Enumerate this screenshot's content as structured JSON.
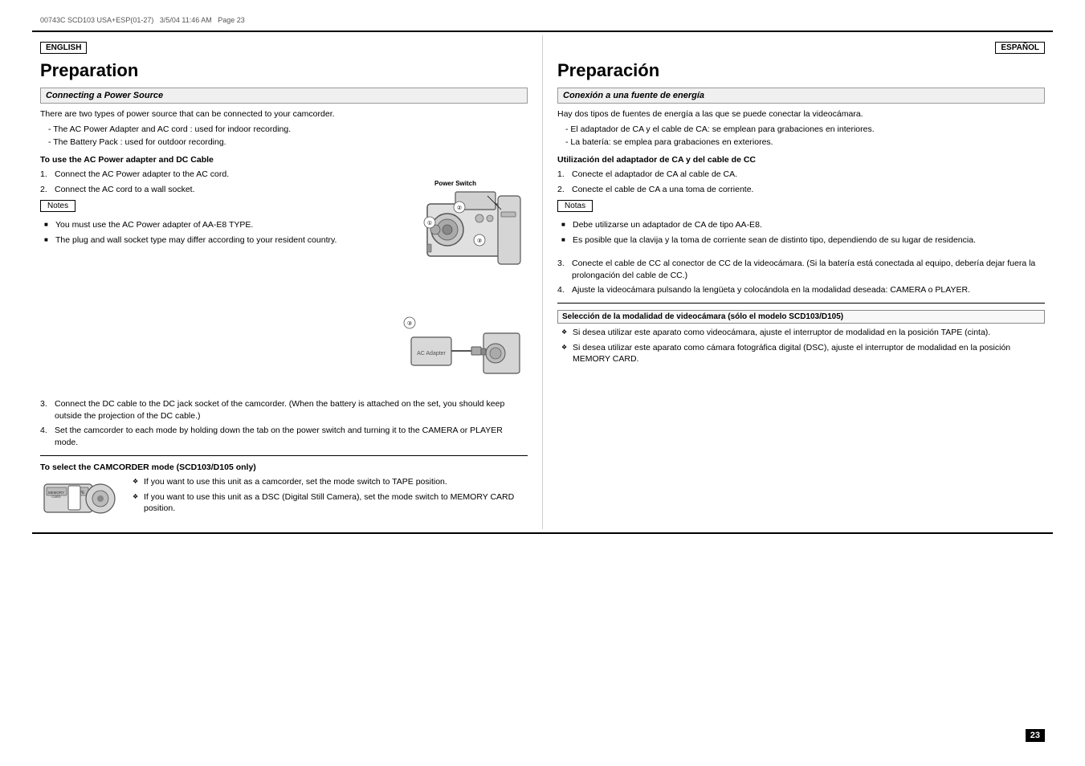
{
  "meta": {
    "doc_id": "00743C SCD103 USA+ESP(01-27)",
    "date": "3/5/04 11:46 AM",
    "page": "Page 23"
  },
  "english": {
    "lang_badge": "ENGLISH",
    "title": "Preparation",
    "section1": {
      "header": "Connecting a Power Source",
      "intro": "There are two types of power source that can be connected to your camcorder.",
      "bullets": [
        "The AC Power Adapter and AC cord : used for indoor recording.",
        "The Battery Pack : used for outdoor recording."
      ],
      "subheading": "To use the AC Power adapter and DC Cable",
      "steps": [
        "Connect the AC Power adapter to the AC cord.",
        "Connect the AC cord to a wall socket.",
        "Connect the DC cable to the DC jack socket of the camcorder. (When the battery is attached on the set, you should keep outside the projection of the DC cable.)",
        "Set the camcorder to each mode by holding down the tab on the power switch and turning it to the CAMERA or PLAYER mode."
      ],
      "notes_label": "Notes",
      "notes": [
        "You must use the AC Power adapter of AA-E8 TYPE.",
        "The plug and wall socket type may differ according to your resident country."
      ]
    },
    "section2": {
      "subheading": "To select the CAMCORDER mode (SCD103/D105 only)",
      "bullets": [
        "If you want to use this unit as a camcorder, set the mode switch to TAPE position.",
        "If you want to use this unit as a DSC (Digital Still Camera), set the mode switch to MEMORY CARD position."
      ]
    },
    "power_switch_label": "Power Switch"
  },
  "spanish": {
    "lang_badge": "ESPAÑOL",
    "title": "Preparación",
    "section1": {
      "header": "Conexión a una fuente de energía",
      "intro": "Hay dos tipos de fuentes de energía a las que se puede conectar la videocámara.",
      "bullets": [
        "El adaptador de CA y el cable de CA: se emplean para grabaciones en interiores.",
        "La batería: se emplea para grabaciones en exteriores."
      ],
      "subheading": "Utilización del adaptador de CA y del cable de CC",
      "steps": [
        "Conecte el adaptador de CA al cable de CA.",
        "Conecte el cable de CA a una toma de corriente.",
        "Conecte el cable de CC al conector de CC de la videocámara. (Si la batería está conectada al equipo, debería dejar fuera la prolongación del cable de CC.)",
        "Ajuste la videocámara pulsando la lengüeta y colocándola en la modalidad deseada: CAMERA o PLAYER."
      ],
      "notes_label": "Notas",
      "notes": [
        "Debe utilizarse un adaptador de CA de tipo AA-E8.",
        "Es posible que la clavija y la toma de corriente sean de distinto tipo, dependiendo de su lugar de residencia."
      ]
    },
    "section2": {
      "subheading": "Selección de la modalidad de videocámara (sólo el modelo SCD103/D105)",
      "bullets": [
        "Si desea utilizar este aparato como videocámara, ajuste el interruptor de modalidad en la posición TAPE (cinta).",
        "Si desea utilizar este aparato como cámara fotográfica digital (DSC), ajuste el interruptor de modalidad en la posición MEMORY CARD."
      ]
    }
  },
  "page_number": "23"
}
